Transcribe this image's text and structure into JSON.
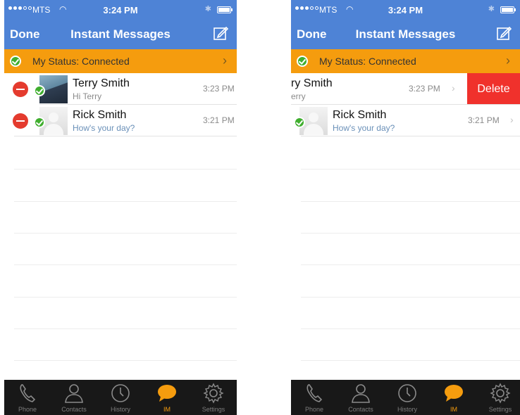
{
  "screens": [
    {
      "status_bar": {
        "carrier": "MTS",
        "time": "3:24 PM"
      },
      "nav": {
        "left_button": "Done",
        "title": "Instant Messages"
      },
      "my_status": {
        "label": "My Status: Connected"
      },
      "rows": [
        {
          "name": "Terry Smith",
          "message": "Hi Terry",
          "time": "3:23 PM"
        },
        {
          "name": "Rick Smith",
          "message": "How's your day?",
          "time": "3:21 PM"
        }
      ],
      "tabs": [
        {
          "label": "Phone",
          "icon": "phone-icon"
        },
        {
          "label": "Contacts",
          "icon": "person-icon"
        },
        {
          "label": "History",
          "icon": "clock-icon"
        },
        {
          "label": "IM",
          "icon": "chat-bubble-icon",
          "active": true
        },
        {
          "label": "Settings",
          "icon": "gear-icon"
        }
      ]
    },
    {
      "status_bar": {
        "carrier": "MTS",
        "time": "3:24 PM"
      },
      "nav": {
        "left_button": "Done",
        "title": "Instant Messages"
      },
      "my_status": {
        "label": "My Status: Connected"
      },
      "rows": [
        {
          "name_partial": "ry Smith",
          "message_partial": "erry",
          "time": "3:23 PM",
          "delete_label": "Delete"
        },
        {
          "name": "Rick Smith",
          "message": "How's your day?",
          "time": "3:21 PM"
        }
      ],
      "tabs": [
        {
          "label": "Phone",
          "icon": "phone-icon"
        },
        {
          "label": "Contacts",
          "icon": "person-icon"
        },
        {
          "label": "History",
          "icon": "clock-icon"
        },
        {
          "label": "IM",
          "icon": "chat-bubble-icon",
          "active": true
        },
        {
          "label": "Settings",
          "icon": "gear-icon"
        }
      ]
    }
  ],
  "colors": {
    "nav_blue": "#4e83d6",
    "status_orange": "#f59c0e",
    "online_green": "#3fae2e",
    "delete_red": "#f0312c",
    "tabbar_black": "#181818"
  }
}
